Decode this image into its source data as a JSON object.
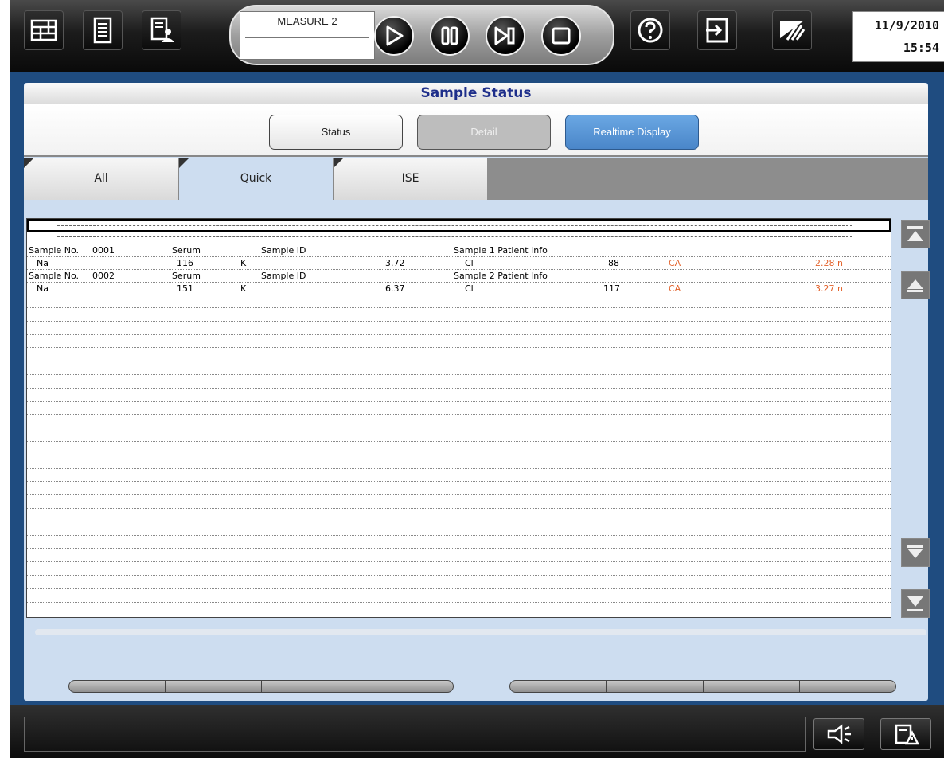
{
  "toolbar": {
    "left_buttons": [
      "system-overview-icon",
      "worklist-icon",
      "patient-info-icon"
    ],
    "measure_label": "MEASURE 2",
    "control_buttons": [
      "start-icon",
      "pause-icon",
      "sampling-stop-icon",
      "stop-icon"
    ],
    "right_buttons": [
      "help-icon",
      "logout-icon",
      "monitor-icon"
    ],
    "date": "11/9/2010",
    "time": "15:54"
  },
  "panel": {
    "title": "Sample Status",
    "buttons": {
      "status": "Status",
      "detail": "Detail",
      "realtime": "Realtime Display"
    },
    "tabs": [
      {
        "label": "All",
        "active": false
      },
      {
        "label": "Quick",
        "active": true
      },
      {
        "label": "ISE",
        "active": false
      }
    ]
  },
  "samples": [
    {
      "sample_no_label": "Sample No.",
      "sample_no": "0001",
      "type": "Serum",
      "sample_id_label": "Sample ID",
      "patient_info": "Sample 1  Patient Info",
      "results": {
        "na_label": "Na",
        "na_value": "116",
        "k_label": "K",
        "k_value": "3.72",
        "cl_label": "Cl",
        "cl_value": "88",
        "ca_label": "CA",
        "ca_value": "2.28 n"
      }
    },
    {
      "sample_no_label": "Sample No.",
      "sample_no": "0002",
      "type": "Serum",
      "sample_id_label": "Sample ID",
      "patient_info": "Sample 2  Patient Info",
      "results": {
        "na_label": "Na",
        "na_value": "151",
        "k_label": "K",
        "k_value": "6.37",
        "cl_label": "Cl",
        "cl_value": "117",
        "ca_label": "CA",
        "ca_value": "3.27 n"
      }
    }
  ],
  "colors": {
    "frame": "#1f4c80",
    "panel": "#cdddf0",
    "title_text": "#1e2e8a",
    "realtime_button": "#4a86c9",
    "flag_orange": "#e2612a"
  },
  "bottom": {
    "buttons": [
      "alarm-icon",
      "warning-report-icon"
    ]
  }
}
